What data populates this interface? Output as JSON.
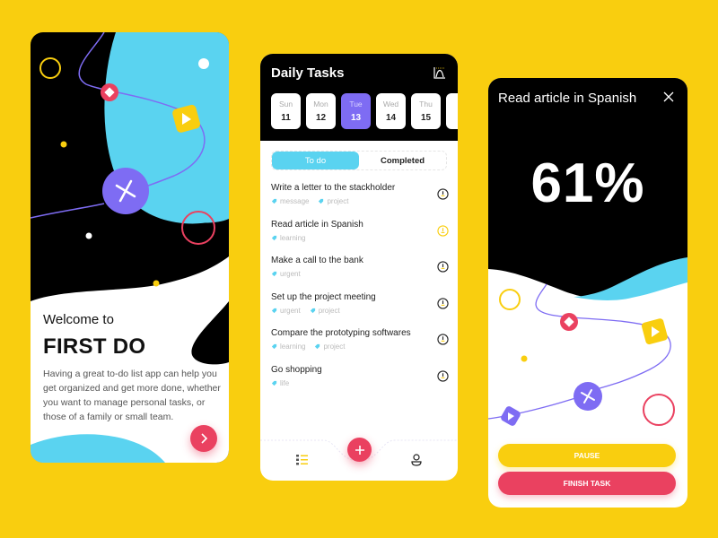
{
  "colors": {
    "background": "#F9CE0F",
    "primary_purple": "#7E6CF3",
    "accent_red": "#EA4160",
    "accent_cyan": "#5AD3F0",
    "accent_yellow": "#F9CE0F",
    "dark": "#000000"
  },
  "onboarding": {
    "welcome": "Welcome to",
    "app_name": "FIRST DO",
    "description": "Having a great to-do list app can help you get organized and get more done, whether you want to manage personal tasks, or those of a family or small team.",
    "next_icon": "chevron-right-icon"
  },
  "daily": {
    "title": "Daily Tasks",
    "chart_icon": "chart-icon",
    "days": [
      {
        "name": "Sun",
        "date": "11",
        "active": false
      },
      {
        "name": "Mon",
        "date": "12",
        "active": false
      },
      {
        "name": "Tue",
        "date": "13",
        "active": true
      },
      {
        "name": "Wed",
        "date": "14",
        "active": false
      },
      {
        "name": "Thu",
        "date": "15",
        "active": false
      }
    ],
    "tabs": {
      "todo": "To do",
      "completed": "Completed"
    },
    "tasks": [
      {
        "title": "Write a letter to the stackholder",
        "tags": [
          "message",
          "project"
        ],
        "clock": "default"
      },
      {
        "title": "Read article in Spanish",
        "tags": [
          "learning"
        ],
        "clock": "active"
      },
      {
        "title": "Make a call to the bank",
        "tags": [
          "urgent"
        ],
        "clock": "default"
      },
      {
        "title": "Set up the project meeting",
        "tags": [
          "urgent",
          "project"
        ],
        "clock": "default"
      },
      {
        "title": "Compare the prototyping softwares",
        "tags": [
          "learning",
          "project"
        ],
        "clock": "default"
      },
      {
        "title": "Go shopping",
        "tags": [
          "life"
        ],
        "clock": "default"
      }
    ],
    "tabbar": {
      "list_icon": "list-icon",
      "add_icon": "plus-icon",
      "profile_icon": "user-icon"
    }
  },
  "progress": {
    "task_title": "Read article in Spanish",
    "percent_label": "61%",
    "percent_value": 61,
    "pause_label": "PAUSE",
    "finish_label": "FINISH TASK",
    "close_icon": "close-icon"
  }
}
